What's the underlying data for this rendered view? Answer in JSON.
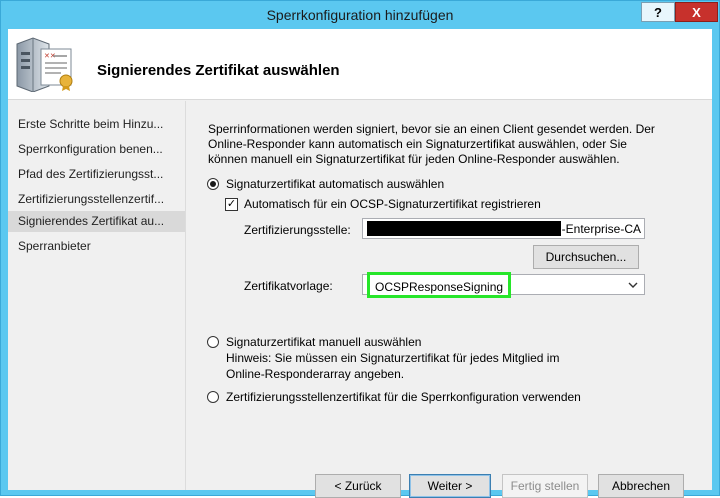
{
  "window": {
    "title": "Sperrkonfiguration hinzufügen",
    "help_label": "?",
    "close_label": "X"
  },
  "header": {
    "title": "Signierendes Zertifikat auswählen",
    "icon": "server-certificate-icon"
  },
  "nav": {
    "items": [
      {
        "label": "Erste Schritte beim Hinzu..."
      },
      {
        "label": "Sperrkonfiguration benen..."
      },
      {
        "label": "Pfad des Zertifizierungsst..."
      },
      {
        "label": "Zertifizierungsstellenzertif..."
      },
      {
        "label": "Signierendes Zertifikat au..."
      },
      {
        "label": "Sperranbieter"
      }
    ],
    "active_index": 4
  },
  "content": {
    "intro": "Sperrinformationen werden signiert, bevor sie an einen Client gesendet werden. Der Online-Responder kann automatisch ein Signaturzertifikat auswählen, oder Sie können manuell ein Signaturzertifikat für jeden Online-Responder auswählen.",
    "option_auto": {
      "label": "Signaturzertifikat automatisch auswählen",
      "selected": true
    },
    "auto_enroll": {
      "label": "Automatisch für ein OCSP-Signaturzertifikat registrieren",
      "checked": true,
      "check_glyph": "✓"
    },
    "ca": {
      "label": "Zertifizierungsstelle:",
      "value_suffix": "-Enterprise-CA"
    },
    "browse_label": "Durchsuchen...",
    "template": {
      "label": "Zertifikatvorlage:",
      "value": "OCSPResponseSigning",
      "highlight_color": "#27e62a"
    },
    "option_manual": {
      "label": "Signaturzertifikat manuell auswählen",
      "hint_line1": "Hinweis: Sie müssen ein Signaturzertifikat für jedes Mitglied im",
      "hint_line2": "Online-Responderarray angeben.",
      "selected": false
    },
    "option_ca": {
      "label": "Zertifizierungsstellenzertifikat für die Sperrkonfiguration verwenden",
      "selected": false
    }
  },
  "footer": {
    "back_label": "< Zurück",
    "next_label": "Weiter >",
    "finish_label": "Fertig stellen",
    "cancel_label": "Abbrechen"
  },
  "colors": {
    "titlebar": "#5bc8f0",
    "close": "#c7312c",
    "nav_active": "#d9d9d9"
  }
}
